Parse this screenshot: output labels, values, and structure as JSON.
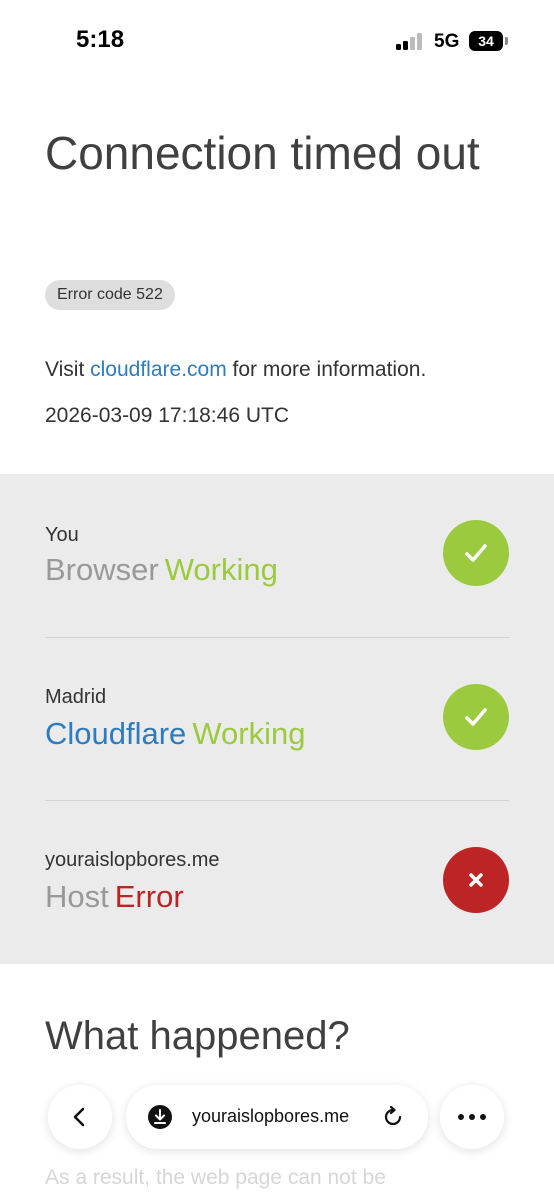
{
  "status_bar": {
    "time": "5:18",
    "network": "5G",
    "battery": "34"
  },
  "page": {
    "title": "Connection timed out",
    "error_code": "Error code 522",
    "visit_prefix": "Visit ",
    "visit_link": "cloudflare.com",
    "visit_suffix": " for more information.",
    "timestamp": "2026-03-09 17:18:46 UTC"
  },
  "status_rows": [
    {
      "location": "You",
      "name": "Browser",
      "state": "Working",
      "status": "ok"
    },
    {
      "location": "Madrid",
      "name": "Cloudflare",
      "state": "Working",
      "status": "ok"
    },
    {
      "location": "youraislopbores.me",
      "name": "Host",
      "state": "Error",
      "status": "error"
    }
  ],
  "what_happened": {
    "heading": "What happened?",
    "body_visible": "As a result, the web page can not be"
  },
  "browser_bar": {
    "url": "youraislopbores.me"
  },
  "colors": {
    "working": "#9bca3e",
    "error": "#bd2426",
    "link": "#2f7bbf"
  }
}
